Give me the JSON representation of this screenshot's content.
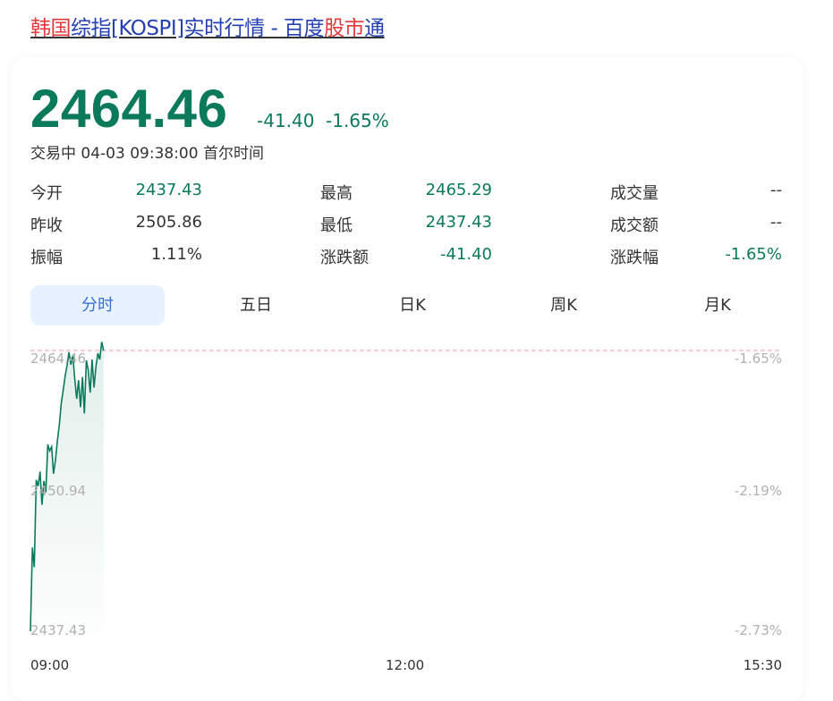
{
  "title": {
    "parts": [
      {
        "text": "韩国",
        "color": "#e4393c"
      },
      {
        "text": "综指[KOSPI]实时行情 - 百度",
        "color": "#2440b3"
      },
      {
        "text": "股市",
        "color": "#e4393c"
      },
      {
        "text": "通",
        "color": "#2440b3"
      }
    ]
  },
  "quote": {
    "price": "2464.46",
    "change": "-41.40",
    "change_pct": "-1.65%",
    "status": "交易中 04-03 09:38:00 首尔时间"
  },
  "stats": [
    [
      {
        "label": "今开",
        "value": "2437.43"
      },
      {
        "label": "最高",
        "value": "2465.29"
      },
      {
        "label": "成交量",
        "value": "--"
      }
    ],
    [
      {
        "label": "昨收",
        "value": "2505.86"
      },
      {
        "label": "最低",
        "value": "2437.43"
      },
      {
        "label": "成交额",
        "value": "--"
      }
    ],
    [
      {
        "label": "振幅",
        "value": "1.11%"
      },
      {
        "label": "涨跌额",
        "value": "-41.40"
      },
      {
        "label": "涨跌幅",
        "value": "-1.65%"
      }
    ]
  ],
  "tabs": [
    "分时",
    "五日",
    "日K",
    "周K",
    "月K"
  ],
  "active_tab": "分时",
  "colors": {
    "down": "#0a7a5a",
    "link_blue": "#2440b3",
    "link_red": "#e4393c",
    "tab_active_bg": "#e8f1ff",
    "tab_active_text": "#3773d6",
    "reference_line": "#f4a0a8"
  },
  "chart_data": {
    "type": "line",
    "y_labels_left": [
      "2464.46",
      "2450.94",
      "2437.43"
    ],
    "y_labels_right": [
      "-1.65%",
      "-2.19%",
      "-2.73%"
    ],
    "x_labels": [
      "09:00",
      "12:00",
      "15:30"
    ],
    "ylim": [
      2437.43,
      2464.46
    ],
    "x_range": [
      "09:00",
      "15:30"
    ],
    "reference_value": 2464.46,
    "series": [
      {
        "x": [
          "09:00",
          "09:01",
          "09:02",
          "09:03",
          "09:04",
          "09:05",
          "09:06",
          "09:07",
          "09:08",
          "09:09",
          "09:10",
          "09:11",
          "09:12",
          "09:13",
          "09:14",
          "09:15",
          "09:16",
          "09:17",
          "09:18",
          "09:19",
          "09:20",
          "09:21",
          "09:22",
          "09:23",
          "09:24",
          "09:25",
          "09:26",
          "09:27",
          "09:28",
          "09:29",
          "09:30",
          "09:31",
          "09:32",
          "09:33",
          "09:34",
          "09:35",
          "09:36",
          "09:37",
          "09:38"
        ],
        "values": [
          2437.43,
          2445.5,
          2443.6,
          2452.0,
          2451.4,
          2452.8,
          2449.6,
          2451.9,
          2450.8,
          2455.4,
          2454.8,
          2455.2,
          2452.6,
          2453.9,
          2455.8,
          2457.3,
          2459.4,
          2460.6,
          2462.0,
          2463.0,
          2464.3,
          2463.1,
          2464.0,
          2461.8,
          2459.8,
          2461.6,
          2459.0,
          2461.9,
          2458.4,
          2463.5,
          2462.6,
          2460.4,
          2463.6,
          2460.9,
          2462.9,
          2464.2,
          2463.6,
          2465.29,
          2464.46
        ]
      }
    ]
  }
}
